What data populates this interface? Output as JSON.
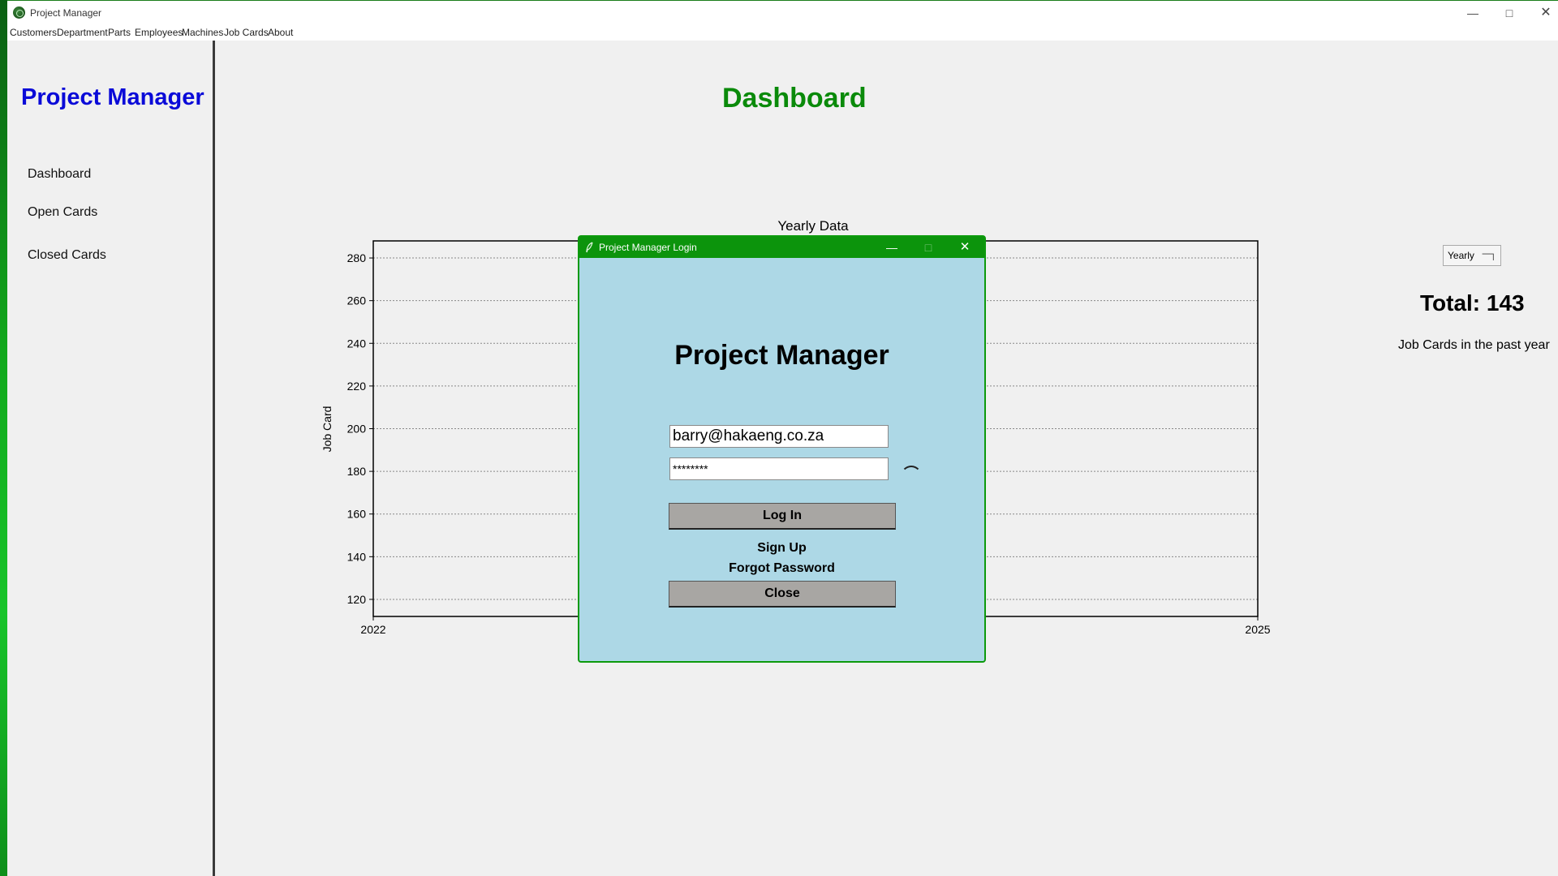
{
  "window": {
    "title": "Project Manager",
    "icon": "app-logo-icon"
  },
  "menu": [
    "Customers",
    "Department",
    "Parts",
    "Employees",
    "Machines",
    "Job Cards",
    "About"
  ],
  "sidebar": {
    "brand": "Project Manager",
    "items": [
      {
        "label": "Dashboard"
      },
      {
        "label": "Open Cards"
      },
      {
        "label": "Closed Cards"
      }
    ]
  },
  "main": {
    "title": "Dashboard",
    "period_select": "Yearly",
    "total": "Total: 143",
    "total_caption": "Job Cards in the past year"
  },
  "chart_data": {
    "type": "line",
    "title": "Yearly Data",
    "xlabel": "",
    "ylabel": "Job Card",
    "x_ticks": [
      "2022",
      "2025"
    ],
    "xlim": [
      2022,
      2025
    ],
    "y_ticks": [
      120,
      140,
      160,
      180,
      200,
      220,
      240,
      260,
      280
    ],
    "ylim": [
      112,
      288
    ],
    "grid": "horizontal dashed",
    "series": []
  },
  "login_dialog": {
    "title": "Project Manager Login",
    "brand": "Project Manager",
    "email_value": "barry@hakaeng.co.za",
    "password_value": "********",
    "login_label": "Log In",
    "signup_label": "Sign Up",
    "forgot_label": "Forgot Password",
    "close_label": "Close"
  },
  "colors": {
    "brand_blue": "#0a0ad8",
    "dashboard_green": "#0a8a0a",
    "dialog_bg": "#add8e6",
    "dialog_titlebar": "#0c940c",
    "button_gray": "#a8a6a3"
  }
}
